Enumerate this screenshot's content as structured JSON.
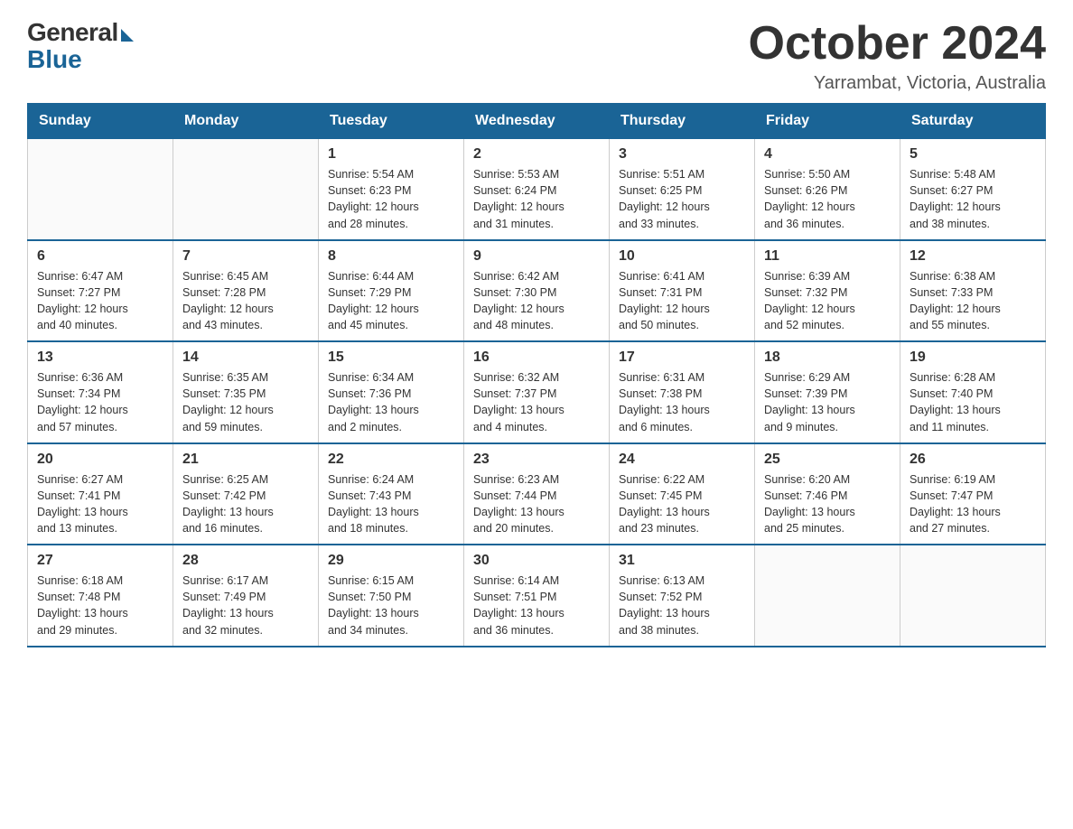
{
  "logo": {
    "general": "General",
    "blue": "Blue"
  },
  "header": {
    "month_year": "October 2024",
    "location": "Yarrambat, Victoria, Australia"
  },
  "days_of_week": [
    "Sunday",
    "Monday",
    "Tuesday",
    "Wednesday",
    "Thursday",
    "Friday",
    "Saturday"
  ],
  "weeks": [
    [
      {
        "day": "",
        "info": ""
      },
      {
        "day": "",
        "info": ""
      },
      {
        "day": "1",
        "info": "Sunrise: 5:54 AM\nSunset: 6:23 PM\nDaylight: 12 hours\nand 28 minutes."
      },
      {
        "day": "2",
        "info": "Sunrise: 5:53 AM\nSunset: 6:24 PM\nDaylight: 12 hours\nand 31 minutes."
      },
      {
        "day": "3",
        "info": "Sunrise: 5:51 AM\nSunset: 6:25 PM\nDaylight: 12 hours\nand 33 minutes."
      },
      {
        "day": "4",
        "info": "Sunrise: 5:50 AM\nSunset: 6:26 PM\nDaylight: 12 hours\nand 36 minutes."
      },
      {
        "day": "5",
        "info": "Sunrise: 5:48 AM\nSunset: 6:27 PM\nDaylight: 12 hours\nand 38 minutes."
      }
    ],
    [
      {
        "day": "6",
        "info": "Sunrise: 6:47 AM\nSunset: 7:27 PM\nDaylight: 12 hours\nand 40 minutes."
      },
      {
        "day": "7",
        "info": "Sunrise: 6:45 AM\nSunset: 7:28 PM\nDaylight: 12 hours\nand 43 minutes."
      },
      {
        "day": "8",
        "info": "Sunrise: 6:44 AM\nSunset: 7:29 PM\nDaylight: 12 hours\nand 45 minutes."
      },
      {
        "day": "9",
        "info": "Sunrise: 6:42 AM\nSunset: 7:30 PM\nDaylight: 12 hours\nand 48 minutes."
      },
      {
        "day": "10",
        "info": "Sunrise: 6:41 AM\nSunset: 7:31 PM\nDaylight: 12 hours\nand 50 minutes."
      },
      {
        "day": "11",
        "info": "Sunrise: 6:39 AM\nSunset: 7:32 PM\nDaylight: 12 hours\nand 52 minutes."
      },
      {
        "day": "12",
        "info": "Sunrise: 6:38 AM\nSunset: 7:33 PM\nDaylight: 12 hours\nand 55 minutes."
      }
    ],
    [
      {
        "day": "13",
        "info": "Sunrise: 6:36 AM\nSunset: 7:34 PM\nDaylight: 12 hours\nand 57 minutes."
      },
      {
        "day": "14",
        "info": "Sunrise: 6:35 AM\nSunset: 7:35 PM\nDaylight: 12 hours\nand 59 minutes."
      },
      {
        "day": "15",
        "info": "Sunrise: 6:34 AM\nSunset: 7:36 PM\nDaylight: 13 hours\nand 2 minutes."
      },
      {
        "day": "16",
        "info": "Sunrise: 6:32 AM\nSunset: 7:37 PM\nDaylight: 13 hours\nand 4 minutes."
      },
      {
        "day": "17",
        "info": "Sunrise: 6:31 AM\nSunset: 7:38 PM\nDaylight: 13 hours\nand 6 minutes."
      },
      {
        "day": "18",
        "info": "Sunrise: 6:29 AM\nSunset: 7:39 PM\nDaylight: 13 hours\nand 9 minutes."
      },
      {
        "day": "19",
        "info": "Sunrise: 6:28 AM\nSunset: 7:40 PM\nDaylight: 13 hours\nand 11 minutes."
      }
    ],
    [
      {
        "day": "20",
        "info": "Sunrise: 6:27 AM\nSunset: 7:41 PM\nDaylight: 13 hours\nand 13 minutes."
      },
      {
        "day": "21",
        "info": "Sunrise: 6:25 AM\nSunset: 7:42 PM\nDaylight: 13 hours\nand 16 minutes."
      },
      {
        "day": "22",
        "info": "Sunrise: 6:24 AM\nSunset: 7:43 PM\nDaylight: 13 hours\nand 18 minutes."
      },
      {
        "day": "23",
        "info": "Sunrise: 6:23 AM\nSunset: 7:44 PM\nDaylight: 13 hours\nand 20 minutes."
      },
      {
        "day": "24",
        "info": "Sunrise: 6:22 AM\nSunset: 7:45 PM\nDaylight: 13 hours\nand 23 minutes."
      },
      {
        "day": "25",
        "info": "Sunrise: 6:20 AM\nSunset: 7:46 PM\nDaylight: 13 hours\nand 25 minutes."
      },
      {
        "day": "26",
        "info": "Sunrise: 6:19 AM\nSunset: 7:47 PM\nDaylight: 13 hours\nand 27 minutes."
      }
    ],
    [
      {
        "day": "27",
        "info": "Sunrise: 6:18 AM\nSunset: 7:48 PM\nDaylight: 13 hours\nand 29 minutes."
      },
      {
        "day": "28",
        "info": "Sunrise: 6:17 AM\nSunset: 7:49 PM\nDaylight: 13 hours\nand 32 minutes."
      },
      {
        "day": "29",
        "info": "Sunrise: 6:15 AM\nSunset: 7:50 PM\nDaylight: 13 hours\nand 34 minutes."
      },
      {
        "day": "30",
        "info": "Sunrise: 6:14 AM\nSunset: 7:51 PM\nDaylight: 13 hours\nand 36 minutes."
      },
      {
        "day": "31",
        "info": "Sunrise: 6:13 AM\nSunset: 7:52 PM\nDaylight: 13 hours\nand 38 minutes."
      },
      {
        "day": "",
        "info": ""
      },
      {
        "day": "",
        "info": ""
      }
    ]
  ]
}
